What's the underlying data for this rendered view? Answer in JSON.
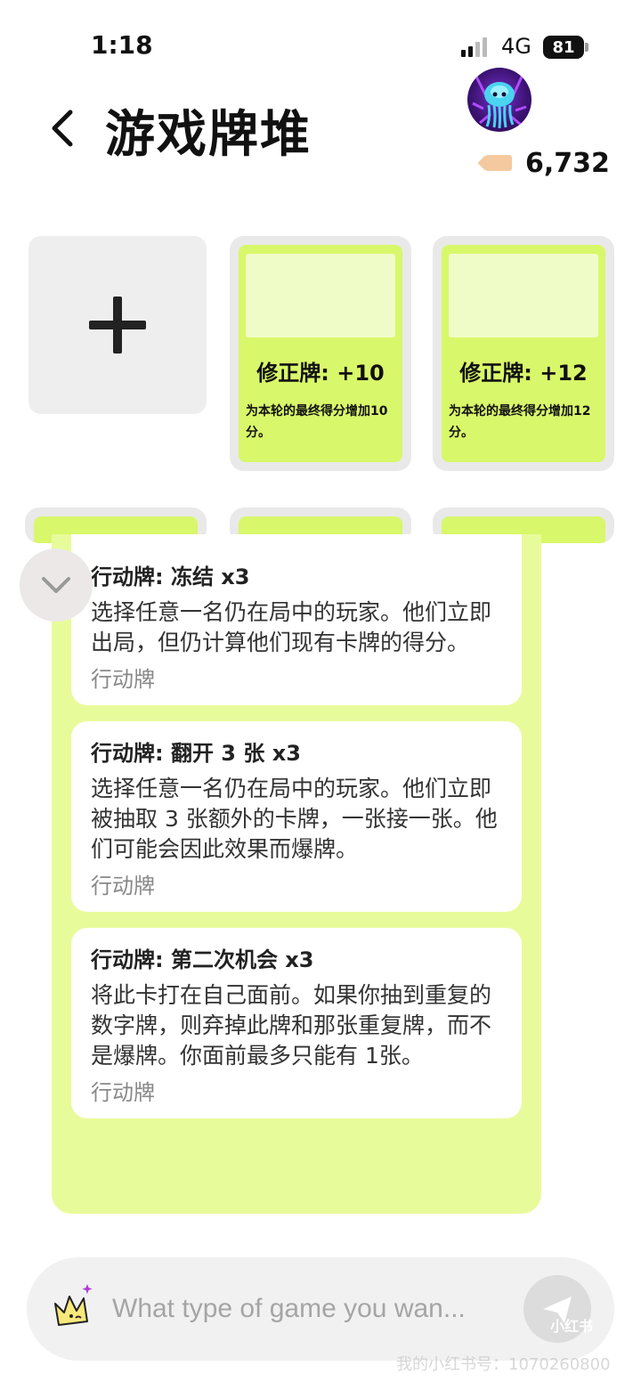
{
  "status_bar": {
    "time": "1:18",
    "network": "4G",
    "battery": "81"
  },
  "header": {
    "title": "游戏牌堆",
    "coin_value": "6,732",
    "avatar_icon": "jellyfish-avatar"
  },
  "deck": {
    "add_icon": "plus-icon",
    "cards": [
      {
        "title": "修正牌: +10",
        "description": "为本轮的最终得分增加10分。"
      },
      {
        "title": "修正牌: +12",
        "description": "为本轮的最终得分增加12分。"
      }
    ]
  },
  "action_list": [
    {
      "title": "行动牌: 冻结 x3",
      "description": "选择任意一名仍在局中的玩家。他们立即出局，但仍计算他们现有卡牌的得分。",
      "type": "行动牌"
    },
    {
      "title": "行动牌: 翻开 3 张 x3",
      "description": "选择任意一名仍在局中的玩家。他们立即被抽取 3 张额外的卡牌，一张接一张。他们可能会因此效果而爆牌。",
      "type": "行动牌"
    },
    {
      "title": "行动牌: 第二次机会 x3",
      "description": "将此卡打在自己面前。如果你抽到重复的数字牌，则弃掉此牌和那张重复牌，而不是爆牌。你面前最多只能有 1张。",
      "type": "行动牌"
    }
  ],
  "prompt": {
    "placeholder": "What type of game you wan..."
  },
  "watermark": {
    "badge": "小红书",
    "text": "我的小红书号：1070260800"
  },
  "colors": {
    "card_lime": "#d9f76a",
    "panel_lime": "#e8fb9b",
    "card_image": "#f0fcc7"
  }
}
